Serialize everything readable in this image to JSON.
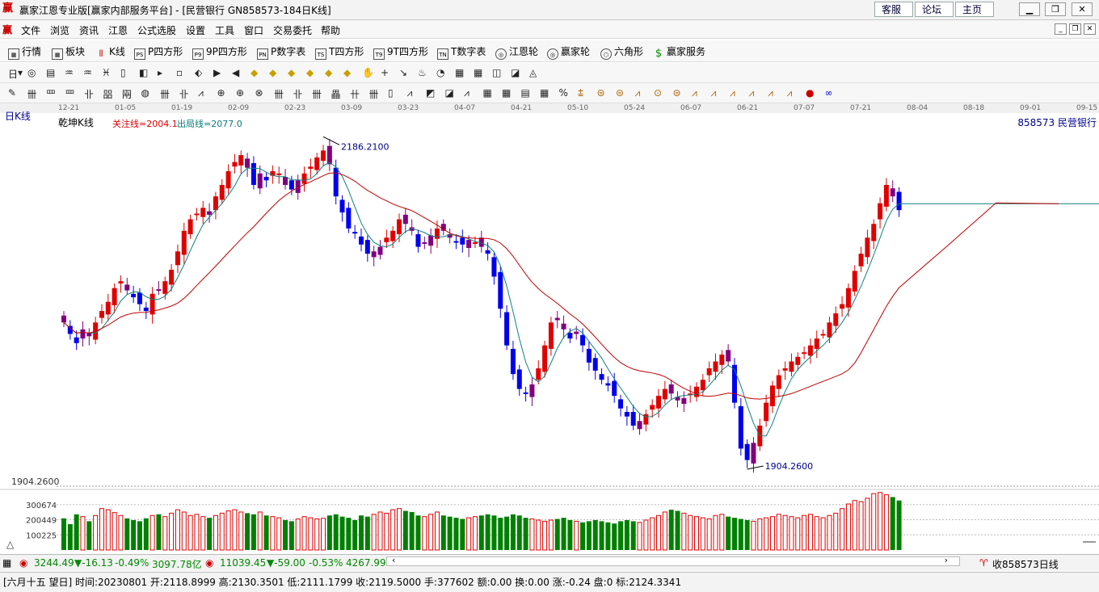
{
  "window": {
    "title": "赢家江恩专业版[赢家内部服务平台] - [民营银行  GN858573-184日K线]",
    "links": [
      "客服",
      "论坛",
      "主页"
    ]
  },
  "menu": [
    "文件",
    "浏览",
    "资讯",
    "江恩",
    "公式选股",
    "设置",
    "工具",
    "窗口",
    "交易委托",
    "帮助"
  ],
  "toolbar": [
    "行情",
    "板块",
    "K线",
    "P四方形",
    "9P四方形",
    "P数字表",
    "T四方形",
    "9T四方形",
    "T数字表",
    "江恩轮",
    "赢家轮",
    "六角形",
    "赢家服务"
  ],
  "toolbar_icon_text": [
    "PS",
    "P9",
    "PN",
    "TS",
    "T9",
    "TN"
  ],
  "chart_header": {
    "period": "日K线",
    "indicator": "乾坤K线",
    "focus_line": "关注线=2004.1",
    "exit_line": "出局线=2077.0",
    "code_name": "858573  民营银行"
  },
  "chart_data": {
    "type": "candlestick",
    "dates": [
      "12-21",
      "01-05",
      "01-19",
      "02-09",
      "02-23",
      "03-09",
      "03-23",
      "04-07",
      "04-21",
      "05-10",
      "05-24",
      "06-07",
      "06-21",
      "07-07",
      "07-21",
      "08-04",
      "08-18",
      "09-01",
      "09-15"
    ],
    "price_high_label": "2186.2100",
    "price_low_label": "1904.2600",
    "price_axis_label": "1904.2600",
    "ylim": [
      1890,
      2200
    ],
    "volume_labels": [
      "300674",
      "200449",
      "100225"
    ],
    "closes": [
      2030,
      2020,
      2012,
      2024,
      2018,
      2030,
      2040,
      2048,
      2060,
      2066,
      2058,
      2052,
      2046,
      2040,
      2055,
      2058,
      2066,
      2076,
      2092,
      2110,
      2120,
      2125,
      2130,
      2124,
      2140,
      2150,
      2162,
      2170,
      2176,
      2165,
      2150,
      2160,
      2154,
      2162,
      2160,
      2150,
      2146,
      2154,
      2160,
      2166,
      2174,
      2180,
      2168,
      2140,
      2126,
      2112,
      2108,
      2098,
      2090,
      2092,
      2096,
      2104,
      2110,
      2120,
      2116,
      2110,
      2096,
      2100,
      2106,
      2112,
      2110,
      2104,
      2100,
      2098,
      2102,
      2100,
      2096,
      2090,
      2070,
      2042,
      2010,
      1985,
      1972,
      1968,
      1976,
      1990,
      2010,
      2030,
      2032,
      2024,
      2016,
      2022,
      2010,
      1995,
      1988,
      1980,
      1975,
      1966,
      1955,
      1948,
      1940,
      1944,
      1950,
      1958,
      1966,
      1972,
      1968,
      1962,
      1964,
      1968,
      1974,
      1980,
      1990,
      1996,
      2002,
      1996,
      1960,
      1920,
      1910,
      1925,
      1940,
      1960,
      1975,
      1984,
      1990,
      1996,
      2000,
      2004,
      2010,
      2016,
      2020,
      2030,
      2038,
      2046,
      2060,
      2075,
      2090,
      2104,
      2116,
      2134,
      2150,
      2140,
      2128
    ],
    "up_flags_pattern": "mixed",
    "volumes": [
      0.55,
      0.45,
      0.62,
      0.58,
      0.5,
      0.6,
      0.72,
      0.7,
      0.65,
      0.6,
      0.55,
      0.52,
      0.5,
      0.55,
      0.6,
      0.62,
      0.58,
      0.64,
      0.7,
      0.66,
      0.6,
      0.62,
      0.58,
      0.56,
      0.6,
      0.64,
      0.68,
      0.7,
      0.66,
      0.64,
      0.62,
      0.66,
      0.6,
      0.58,
      0.56,
      0.52,
      0.5,
      0.54,
      0.58,
      0.56,
      0.54,
      0.55,
      0.6,
      0.62,
      0.58,
      0.56,
      0.52,
      0.6,
      0.58,
      0.62,
      0.66,
      0.64,
      0.7,
      0.72,
      0.68,
      0.66,
      0.6,
      0.58,
      0.62,
      0.66,
      0.6,
      0.58,
      0.56,
      0.54,
      0.56,
      0.58,
      0.6,
      0.62,
      0.6,
      0.56,
      0.58,
      0.62,
      0.6,
      0.56,
      0.54,
      0.52,
      0.5,
      0.52,
      0.54,
      0.56,
      0.52,
      0.5,
      0.48,
      0.5,
      0.52,
      0.5,
      0.48,
      0.46,
      0.5,
      0.52,
      0.5,
      0.48,
      0.52,
      0.56,
      0.6,
      0.66,
      0.7,
      0.68,
      0.64,
      0.6,
      0.58,
      0.56,
      0.54,
      0.6,
      0.62,
      0.58,
      0.56,
      0.54,
      0.52,
      0.5,
      0.54,
      0.56,
      0.58,
      0.62,
      0.6,
      0.58,
      0.56,
      0.6,
      0.62,
      0.58,
      0.56,
      0.6,
      0.64,
      0.72,
      0.8,
      0.86,
      0.84,
      0.9,
      0.98,
      1.0,
      0.96,
      0.92,
      0.86,
      0.8,
      0.76
    ]
  },
  "status": {
    "sh_index": "3244.49",
    "sh_change": "▼-16.13",
    "sh_pct": "-0.49%",
    "sh_amount": "3097.78亿",
    "sz_index": "11039.45",
    "sz_change": "▼-59.00",
    "sz_pct": "-0.53%",
    "sz_amount": "4267.99",
    "right_text": "收858573日线"
  },
  "info": "[六月十五  望日] 时间:20230801 开:2118.8999 高:2130.3501 低:2111.1799 收:2119.5000 手:377602 额:0.00 换:0.00 涨:-0.24 盘:0 标:2124.3341"
}
